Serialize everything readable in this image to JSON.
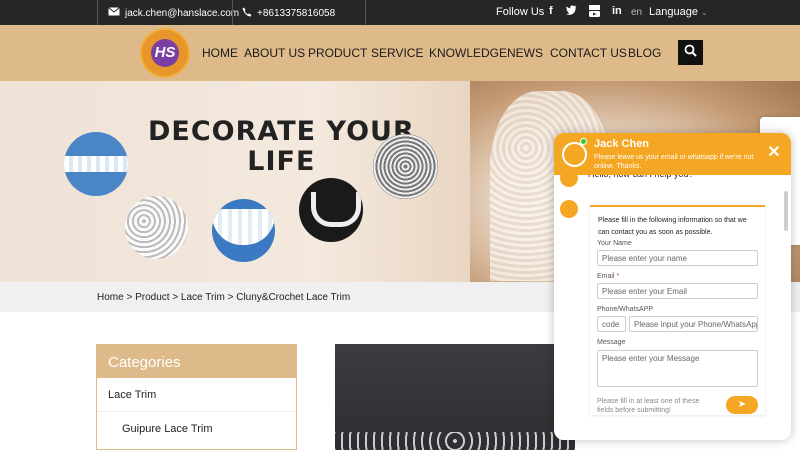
{
  "topbar": {
    "email": "jack.chen@hanslace.com",
    "phone": "+8613375816058",
    "follow": "Follow Us",
    "social": [
      "f",
      "t",
      "yt",
      "in"
    ],
    "lang_code": "en",
    "language": "Language"
  },
  "header": {
    "logo_text": "HS",
    "nav": [
      "HOME",
      "ABOUT US",
      "PRODUCT",
      "SERVICE",
      "KNOWLEDGE",
      "NEWS",
      "CONTACT US",
      "BLOG"
    ]
  },
  "banner": {
    "title_line1": "DECORATE YOUR",
    "title_line2": "LIFE"
  },
  "breadcrumb": "Home > Product > Lace Trim > Cluny&Crochet Lace Trim",
  "categories": {
    "title": "Categories",
    "items": [
      "Lace Trim",
      "Guipure Lace Trim"
    ]
  },
  "chat": {
    "agent_name": "Jack Chen",
    "note": "Please leave us your email or whatsapp if we're not online. Thanks.",
    "greeting": "Hello, how can I help you?",
    "form_intro": "Please fill in the following information so that we can contact you as soon as possible.",
    "name_label": "Your Name",
    "name_placeholder": "Please enter your name",
    "email_label": "Email",
    "email_required": "*",
    "email_placeholder": "Please enter your Email",
    "phone_label": "Phone/WhatsAPP",
    "phone_code": "code",
    "phone_placeholder": "Please input your Phone/WhatsApp",
    "message_label": "Message",
    "message_placeholder": "Please enter your Message",
    "footnote": "Please fill in at least one of these fields before submitting!"
  },
  "colors": {
    "accent": "#deba8a",
    "chat_orange": "#f5a623",
    "topbar": "#262626"
  }
}
